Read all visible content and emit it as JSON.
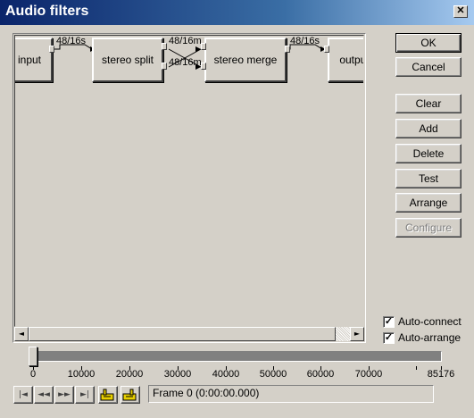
{
  "window": {
    "title": "Audio filters",
    "close_glyph": "✕"
  },
  "graph": {
    "nodes": [
      {
        "id": "input",
        "label": "input"
      },
      {
        "id": "stereo_split",
        "label": "stereo split"
      },
      {
        "id": "stereo_merge",
        "label": "stereo merge"
      },
      {
        "id": "output",
        "label": "output"
      }
    ],
    "connections": [
      {
        "from": "input",
        "to": "stereo_split",
        "label": "48/16s"
      },
      {
        "from": "stereo_split",
        "to": "stereo_merge",
        "label": "48/16m"
      },
      {
        "from": "stereo_split",
        "to": "stereo_merge",
        "label": "48/16m"
      },
      {
        "from": "stereo_merge",
        "to": "output",
        "label": "48/16s"
      }
    ]
  },
  "buttons": {
    "ok": "OK",
    "cancel": "Cancel",
    "clear": "Clear",
    "add": "Add",
    "delete": "Delete",
    "test": "Test",
    "arrange": "Arrange",
    "configure": "Configure"
  },
  "checkboxes": {
    "auto_connect": {
      "label": "Auto-connect",
      "checked": true
    },
    "auto_arrange": {
      "label": "Auto-arrange",
      "checked": true
    }
  },
  "timeline": {
    "ticks": [
      "0",
      "10000",
      "20000",
      "30000",
      "40000",
      "50000",
      "60000",
      "70000",
      "85176"
    ],
    "position_fraction": 0,
    "status": "Frame 0 (0:00:00.000)"
  },
  "transport": [
    {
      "name": "start-icon",
      "glyph": "|◄"
    },
    {
      "name": "prev-keyframe-icon",
      "glyph": "◄◄"
    },
    {
      "name": "next-keyframe-icon",
      "glyph": "►►"
    },
    {
      "name": "end-icon",
      "glyph": "►|"
    },
    {
      "name": "mark-in-icon",
      "glyph": ""
    },
    {
      "name": "mark-out-icon",
      "glyph": ""
    }
  ]
}
